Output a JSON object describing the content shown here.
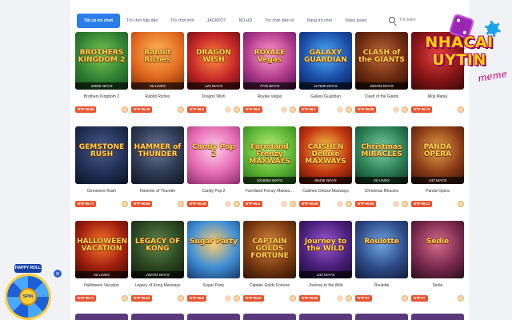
{
  "tabs": [
    {
      "label": "Tất cả trò chơi",
      "active": true
    },
    {
      "label": "Trò chơi hấp dẫn"
    },
    {
      "label": "Trò chơi mới"
    },
    {
      "label": "JACKPOT"
    },
    {
      "label": "NỔ HŨ"
    },
    {
      "label": "Trò chơi điện tử"
    },
    {
      "label": "Bảng trò chơi"
    },
    {
      "label": "Video poker"
    }
  ],
  "search": {
    "placeholder": "Tìm kiếm",
    "icon": "search-icon"
  },
  "rows": [
    [
      {
        "art_title": "BROTHERS KINGDOM 2",
        "foot": "44656 WAYS",
        "name": "Brothers Kingdom 2",
        "rtp": "RTP 96.85"
      },
      {
        "art_title": "Rabbit Riches",
        "foot": "50 LINES",
        "name": "Rabbit Riches",
        "rtp": "RTP 96.49"
      },
      {
        "art_title": "DRAGON WISH",
        "foot": "125 WAYS",
        "name": "Dragon Wish",
        "rtp": "RTP 96.8"
      },
      {
        "art_title": "ROYALE Vegas",
        "foot": "7776 WAYS",
        "name": "Royale Vegas",
        "rtp": "RTP 96.8"
      },
      {
        "art_title": "GALAXY GUARDIAN",
        "foot": "117649 WAYS",
        "name": "Galaxy Guardian",
        "rtp": "RTP 96.7"
      },
      {
        "art_title": "CLASH of the GIANTS",
        "foot": "200704 WAYS",
        "name": "Clash of the Giants",
        "rtp": "RTP 96.88"
      },
      {
        "art_title": "",
        "foot": "",
        "name": "Moji Mania",
        "rtp": "RTP 96.75"
      }
    ],
    [
      {
        "art_title": "GEMSTONE RUSH",
        "foot": "",
        "name": "Gemstone Rush",
        "rtp": "RTP 96.77"
      },
      {
        "art_title": "HAMMER of THUNDER",
        "foot": "",
        "name": "Hammer of Thunder",
        "rtp": "RTP 96.89"
      },
      {
        "art_title": "Candy Pop 2",
        "foot": "",
        "name": "Candy Pop 2",
        "rtp": "RTP 96.45"
      },
      {
        "art_title": "Farmland Frenzy MAXWAYS",
        "foot": "1016064 WAYS",
        "name": "Farmland Frenzy Maxwa…",
        "rtp": "RTP 96.4"
      },
      {
        "art_title": "CAISHEN Deluxe MAXWAYS",
        "foot": "86436 WAYS",
        "name": "Caishen Deluxe Maxways",
        "rtp": "RTP 96.09"
      },
      {
        "art_title": "Christmas MIRACLES",
        "foot": "50 LINES",
        "name": "Christmas Miracles",
        "rtp": "RTP 96.65"
      },
      {
        "art_title": "PANDA OPERA",
        "foot": "243 WAYS",
        "name": "Panda Opera",
        "rtp": "RTP 96.11"
      }
    ],
    [
      {
        "art_title": "HALLOWEEN VACATION",
        "foot": "50 LINES",
        "name": "Halloween Vacation",
        "rtp": "RTP 96.71"
      },
      {
        "art_title": "LEGACY OF KONG",
        "foot": "200704 WAYS",
        "name": "Legacy of Kong Maxways",
        "rtp": "RTP 96.63"
      },
      {
        "art_title": "Sugar Party",
        "foot": "",
        "name": "Sugar Party",
        "rtp": "RTP 96.6"
      },
      {
        "art_title": "CAPTAIN GOLDS FORTUNE",
        "foot": "",
        "name": "Captain Golds Fortune",
        "rtp": "RTP 96.87"
      },
      {
        "art_title": "Journey to the WILD",
        "foot": "243 WAYS",
        "name": "Journey to the Wild",
        "rtp": "RTP 96.55"
      },
      {
        "art_title": "Roulette",
        "foot": "",
        "name": "Roulette",
        "rtp": "RTP 97"
      },
      {
        "art_title": "Sedie",
        "foot": "",
        "name": "Sedie",
        "rtp": "RTP 97"
      }
    ]
  ],
  "logo": {
    "line1": "NHACAI",
    "line2": "UYTIN",
    "line3": "meme"
  },
  "spin": {
    "brand": "HAPPY ROLL",
    "label": "SPIN",
    "close": "×"
  }
}
